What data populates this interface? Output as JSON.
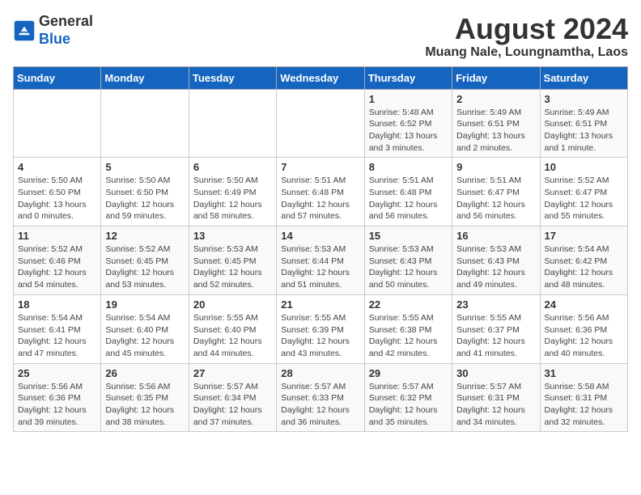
{
  "header": {
    "logo_line1": "General",
    "logo_line2": "Blue",
    "title": "August 2024",
    "subtitle": "Muang Nale, Loungnamtha, Laos"
  },
  "weekdays": [
    "Sunday",
    "Monday",
    "Tuesday",
    "Wednesday",
    "Thursday",
    "Friday",
    "Saturday"
  ],
  "weeks": [
    [
      {
        "day": "",
        "info": ""
      },
      {
        "day": "",
        "info": ""
      },
      {
        "day": "",
        "info": ""
      },
      {
        "day": "",
        "info": ""
      },
      {
        "day": "1",
        "info": "Sunrise: 5:48 AM\nSunset: 6:52 PM\nDaylight: 13 hours\nand 3 minutes."
      },
      {
        "day": "2",
        "info": "Sunrise: 5:49 AM\nSunset: 6:51 PM\nDaylight: 13 hours\nand 2 minutes."
      },
      {
        "day": "3",
        "info": "Sunrise: 5:49 AM\nSunset: 6:51 PM\nDaylight: 13 hours\nand 1 minute."
      }
    ],
    [
      {
        "day": "4",
        "info": "Sunrise: 5:50 AM\nSunset: 6:50 PM\nDaylight: 13 hours\nand 0 minutes."
      },
      {
        "day": "5",
        "info": "Sunrise: 5:50 AM\nSunset: 6:50 PM\nDaylight: 12 hours\nand 59 minutes."
      },
      {
        "day": "6",
        "info": "Sunrise: 5:50 AM\nSunset: 6:49 PM\nDaylight: 12 hours\nand 58 minutes."
      },
      {
        "day": "7",
        "info": "Sunrise: 5:51 AM\nSunset: 6:48 PM\nDaylight: 12 hours\nand 57 minutes."
      },
      {
        "day": "8",
        "info": "Sunrise: 5:51 AM\nSunset: 6:48 PM\nDaylight: 12 hours\nand 56 minutes."
      },
      {
        "day": "9",
        "info": "Sunrise: 5:51 AM\nSunset: 6:47 PM\nDaylight: 12 hours\nand 56 minutes."
      },
      {
        "day": "10",
        "info": "Sunrise: 5:52 AM\nSunset: 6:47 PM\nDaylight: 12 hours\nand 55 minutes."
      }
    ],
    [
      {
        "day": "11",
        "info": "Sunrise: 5:52 AM\nSunset: 6:46 PM\nDaylight: 12 hours\nand 54 minutes."
      },
      {
        "day": "12",
        "info": "Sunrise: 5:52 AM\nSunset: 6:45 PM\nDaylight: 12 hours\nand 53 minutes."
      },
      {
        "day": "13",
        "info": "Sunrise: 5:53 AM\nSunset: 6:45 PM\nDaylight: 12 hours\nand 52 minutes."
      },
      {
        "day": "14",
        "info": "Sunrise: 5:53 AM\nSunset: 6:44 PM\nDaylight: 12 hours\nand 51 minutes."
      },
      {
        "day": "15",
        "info": "Sunrise: 5:53 AM\nSunset: 6:43 PM\nDaylight: 12 hours\nand 50 minutes."
      },
      {
        "day": "16",
        "info": "Sunrise: 5:53 AM\nSunset: 6:43 PM\nDaylight: 12 hours\nand 49 minutes."
      },
      {
        "day": "17",
        "info": "Sunrise: 5:54 AM\nSunset: 6:42 PM\nDaylight: 12 hours\nand 48 minutes."
      }
    ],
    [
      {
        "day": "18",
        "info": "Sunrise: 5:54 AM\nSunset: 6:41 PM\nDaylight: 12 hours\nand 47 minutes."
      },
      {
        "day": "19",
        "info": "Sunrise: 5:54 AM\nSunset: 6:40 PM\nDaylight: 12 hours\nand 45 minutes."
      },
      {
        "day": "20",
        "info": "Sunrise: 5:55 AM\nSunset: 6:40 PM\nDaylight: 12 hours\nand 44 minutes."
      },
      {
        "day": "21",
        "info": "Sunrise: 5:55 AM\nSunset: 6:39 PM\nDaylight: 12 hours\nand 43 minutes."
      },
      {
        "day": "22",
        "info": "Sunrise: 5:55 AM\nSunset: 6:38 PM\nDaylight: 12 hours\nand 42 minutes."
      },
      {
        "day": "23",
        "info": "Sunrise: 5:55 AM\nSunset: 6:37 PM\nDaylight: 12 hours\nand 41 minutes."
      },
      {
        "day": "24",
        "info": "Sunrise: 5:56 AM\nSunset: 6:36 PM\nDaylight: 12 hours\nand 40 minutes."
      }
    ],
    [
      {
        "day": "25",
        "info": "Sunrise: 5:56 AM\nSunset: 6:36 PM\nDaylight: 12 hours\nand 39 minutes."
      },
      {
        "day": "26",
        "info": "Sunrise: 5:56 AM\nSunset: 6:35 PM\nDaylight: 12 hours\nand 38 minutes."
      },
      {
        "day": "27",
        "info": "Sunrise: 5:57 AM\nSunset: 6:34 PM\nDaylight: 12 hours\nand 37 minutes."
      },
      {
        "day": "28",
        "info": "Sunrise: 5:57 AM\nSunset: 6:33 PM\nDaylight: 12 hours\nand 36 minutes."
      },
      {
        "day": "29",
        "info": "Sunrise: 5:57 AM\nSunset: 6:32 PM\nDaylight: 12 hours\nand 35 minutes."
      },
      {
        "day": "30",
        "info": "Sunrise: 5:57 AM\nSunset: 6:31 PM\nDaylight: 12 hours\nand 34 minutes."
      },
      {
        "day": "31",
        "info": "Sunrise: 5:58 AM\nSunset: 6:31 PM\nDaylight: 12 hours\nand 32 minutes."
      }
    ]
  ]
}
